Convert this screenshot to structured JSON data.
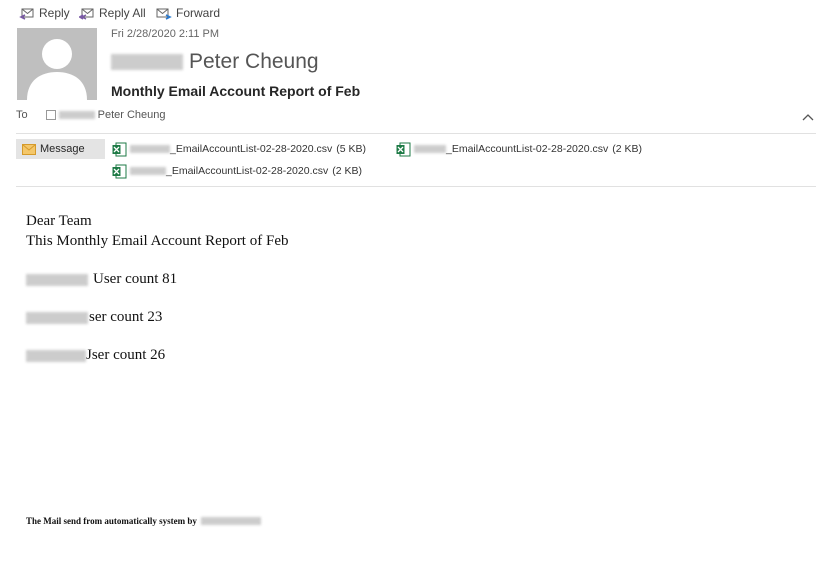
{
  "toolbar": {
    "reply_label": "Reply",
    "reply_all_label": "Reply All",
    "forward_label": "Forward"
  },
  "header": {
    "date": "Fri 2/28/2020 2:11 PM",
    "sender_name": "Peter Cheung",
    "subject": "Monthly Email Account Report of Feb",
    "to_label": "To",
    "recipient_name": "Peter Cheung"
  },
  "attachments": {
    "message_tab_label": "Message",
    "files": [
      {
        "name": "_EmailAccountList-02-28-2020.csv",
        "size": "(5 KB)"
      },
      {
        "name": "_EmailAccountList-02-28-2020.csv",
        "size": "(2 KB)"
      },
      {
        "name": "_EmailAccountList-02-28-2020.csv",
        "size": "(2 KB)"
      }
    ]
  },
  "body": {
    "greeting": "Dear Team",
    "intro": "This Monthly Email Account Report of Feb",
    "counts": [
      {
        "text": "User count 81"
      },
      {
        "text": "ser count 23"
      },
      {
        "text": "Jser count 26"
      }
    ],
    "footer": "The Mail send from automatically system by"
  },
  "colors": {
    "reply_icon": "#7a5aa6",
    "forward_icon": "#2b7cd3",
    "excel_green": "#1d7a45",
    "message_tab_bg": "#e4e4e4"
  }
}
